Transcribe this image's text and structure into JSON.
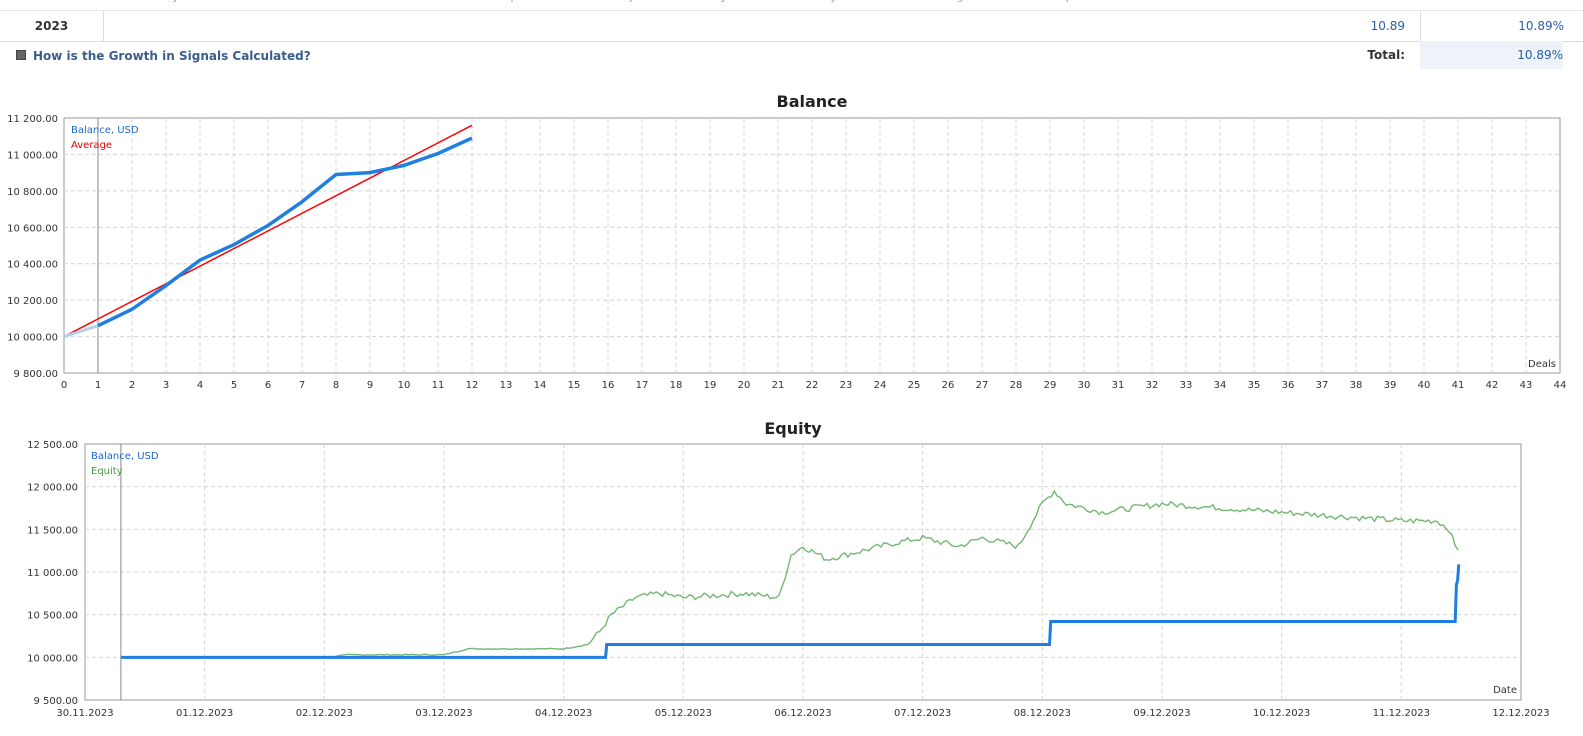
{
  "table": {
    "month_headers": [
      "Jan",
      "Feb",
      "Mar",
      "Apr",
      "May",
      "Jun",
      "Jul",
      "Aug",
      "Sep",
      "Oct",
      "Nov",
      "Dec",
      "YTD"
    ],
    "rows": [
      {
        "year": "2023",
        "dec": "10.89",
        "ytd": "10.89%"
      }
    ],
    "help_link": "How is the Growth in Signals Calculated?",
    "total_label": "Total:",
    "total_value": "10.89%"
  },
  "chart_data": [
    {
      "type": "line",
      "title": "Balance",
      "xlabel": "Deals",
      "legend": [
        "Balance, USD",
        "Average"
      ],
      "legend_placement": "top-left",
      "grid": true,
      "xlim": [
        0,
        44
      ],
      "ylim": [
        9800,
        11200
      ],
      "yticks": [
        "11 200.00",
        "11 000.00",
        "10 800.00",
        "10 600.00",
        "10 400.00",
        "10 200.00",
        "10 000.00",
        "9 800.00"
      ],
      "series": [
        {
          "name": "Balance, USD",
          "color": "#1f7fe0",
          "x": [
            0,
            1,
            2,
            3,
            4,
            5,
            6,
            7,
            8,
            9,
            10,
            11,
            12
          ],
          "y": [
            10000,
            10060,
            10150,
            10280,
            10420,
            10505,
            10610,
            10740,
            10890,
            10900,
            10940,
            11005,
            11090
          ]
        },
        {
          "name": "Average",
          "color": "#ff0000",
          "x": [
            0,
            12
          ],
          "y": [
            10000,
            11160
          ]
        }
      ]
    },
    {
      "type": "line",
      "title": "Equity",
      "xlabel": "Date",
      "legend": [
        "Balance, USD",
        "Equity"
      ],
      "legend_placement": "top-left",
      "grid": true,
      "ylim": [
        9500,
        12500
      ],
      "yticks": [
        "12 500.00",
        "12 000.00",
        "11 500.00",
        "11 000.00",
        "10 500.00",
        "10 000.00",
        "9 500.00"
      ],
      "xticks": [
        "30.11.2023",
        "01.12.2023",
        "02.12.2023",
        "03.12.2023",
        "04.12.2023",
        "05.12.2023",
        "06.12.2023",
        "07.12.2023",
        "08.12.2023",
        "09.12.2023",
        "10.12.2023",
        "11.12.2023",
        "12.12.2023"
      ],
      "series": [
        {
          "name": "Balance, USD",
          "color": "#1f7fe0",
          "x": [
            0.3,
            1.0,
            2.0,
            3.0,
            4.0,
            4.35,
            4.36,
            5.0,
            6.0,
            7.0,
            7.05,
            8.06,
            8.07,
            9.0,
            10.0,
            11.0,
            11.45,
            11.46,
            11.47,
            11.48
          ],
          "y": [
            10000,
            10000,
            10000,
            10000,
            10000,
            10000,
            10150,
            10150,
            10150,
            10150,
            10150,
            10150,
            10420,
            10420,
            10420,
            10420,
            10420,
            10850,
            10900,
            11090
          ]
        },
        {
          "name": "Equity",
          "color": "#5aaa5a",
          "x": [
            0.3,
            1.0,
            2.0,
            2.2,
            3.0,
            3.2,
            3.5,
            4.0,
            4.2,
            4.3,
            4.4,
            4.6,
            4.8,
            5.0,
            5.5,
            5.8,
            5.9,
            6.0,
            6.2,
            6.5,
            6.8,
            7.0,
            7.3,
            7.5,
            7.8,
            8.0,
            8.1,
            8.2,
            8.5,
            9.0,
            9.5,
            10.0,
            10.5,
            11.0,
            11.3,
            11.4,
            11.45,
            11.5
          ],
          "y": [
            10000,
            10000,
            10000,
            10030,
            10030,
            10100,
            10100,
            10100,
            10150,
            10300,
            10500,
            10700,
            10750,
            10700,
            10750,
            10700,
            11200,
            11300,
            11150,
            11250,
            11350,
            11400,
            11300,
            11400,
            11300,
            11800,
            11950,
            11800,
            11700,
            11800,
            11750,
            11700,
            11650,
            11600,
            11600,
            11500,
            11300,
            11250
          ]
        }
      ]
    }
  ]
}
